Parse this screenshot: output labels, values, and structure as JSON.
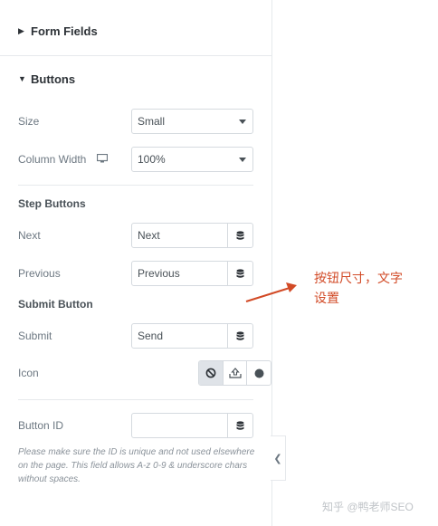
{
  "sections": {
    "form_fields": "Form Fields",
    "buttons": "Buttons"
  },
  "fields": {
    "size": {
      "label": "Size",
      "value": "Small"
    },
    "column_width": {
      "label": "Column Width",
      "value": "100%"
    },
    "step_buttons": "Step Buttons",
    "next": {
      "label": "Next",
      "value": "Next"
    },
    "previous": {
      "label": "Previous",
      "value": "Previous"
    },
    "submit_button": "Submit Button",
    "submit": {
      "label": "Submit",
      "value": "Send"
    },
    "icon": {
      "label": "Icon"
    },
    "button_id": {
      "label": "Button ID",
      "value": ""
    }
  },
  "help_text": "Please make sure the ID is unique and not used elsewhere on the page. This field allows A-z 0-9 & underscore chars without spaces.",
  "annotation": {
    "line1": "按钮尺寸，文字",
    "line2": "设置",
    "color": "#d24a26"
  },
  "watermark": "知乎 @鸭老师SEO",
  "icons": {
    "dynamic": "database-icon",
    "responsive": "desktop-icon",
    "icon_choices": [
      "none-icon",
      "upload-icon",
      "circle-icon"
    ],
    "collapse": "chevron-left-icon"
  }
}
